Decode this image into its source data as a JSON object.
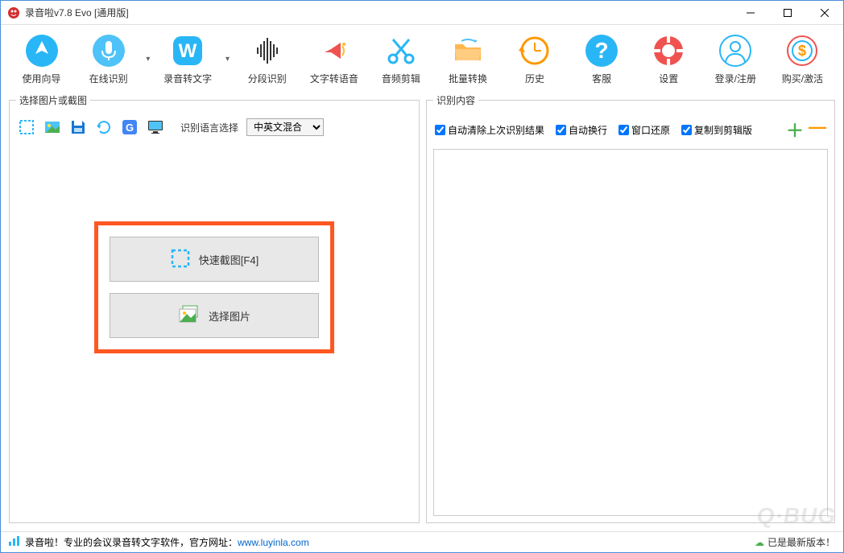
{
  "window": {
    "title": "录音啦v7.8 Evo  [通用版]"
  },
  "toolbar": [
    {
      "id": "guide",
      "label": "使用向导"
    },
    {
      "id": "online",
      "label": "在线识别"
    },
    {
      "id": "rec2text",
      "label": "录音转文字"
    },
    {
      "id": "segment",
      "label": "分段识别"
    },
    {
      "id": "tts",
      "label": "文字转语音"
    },
    {
      "id": "audioedit",
      "label": "音频剪辑"
    },
    {
      "id": "batch",
      "label": "批量转换"
    },
    {
      "id": "history",
      "label": "历史"
    },
    {
      "id": "service",
      "label": "客服"
    },
    {
      "id": "settings",
      "label": "设置"
    },
    {
      "id": "login",
      "label": "登录/注册"
    },
    {
      "id": "buy",
      "label": "购买/激活"
    }
  ],
  "leftPanel": {
    "legend": "选择图片或截图",
    "langLabel": "识别语言选择",
    "langSelected": "中英文混合",
    "quickCapture": "快速截图[F4]",
    "selectImage": "选择图片"
  },
  "rightPanel": {
    "legend": "识别内容",
    "checks": {
      "autoClear": "自动清除上次识别结果",
      "autoWrap": "自动换行",
      "windowRestore": "窗口还原",
      "copyClipboard": "复制到剪辑版"
    }
  },
  "status": {
    "textPrefix": "录音啦！专业的会议录音转文字软件，官方网址：",
    "url": "www.luyinla.com",
    "version": "已是最新版本！"
  },
  "watermark": "Q·BUG"
}
